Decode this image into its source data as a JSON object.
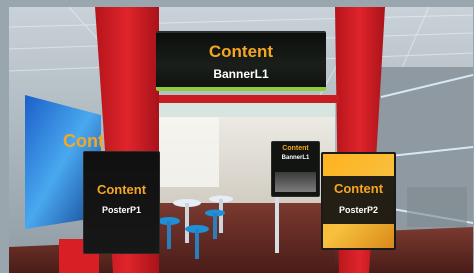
{
  "colors": {
    "content_text": "#f5a623",
    "label_text": "#ffffff",
    "booth_red": "#d81f26",
    "banner_trim": "#8dcc3a"
  },
  "banner": {
    "title": "Content",
    "subtitle": "BannerL1"
  },
  "poster_left": {
    "title": "Content",
    "subtitle": "PosterP1"
  },
  "poster_right": {
    "title": "Content",
    "subtitle": "PosterP2"
  },
  "mini_screen": {
    "title": "Content",
    "subtitle": "BannerL1"
  },
  "wall_screen": {
    "title": "Cont"
  }
}
